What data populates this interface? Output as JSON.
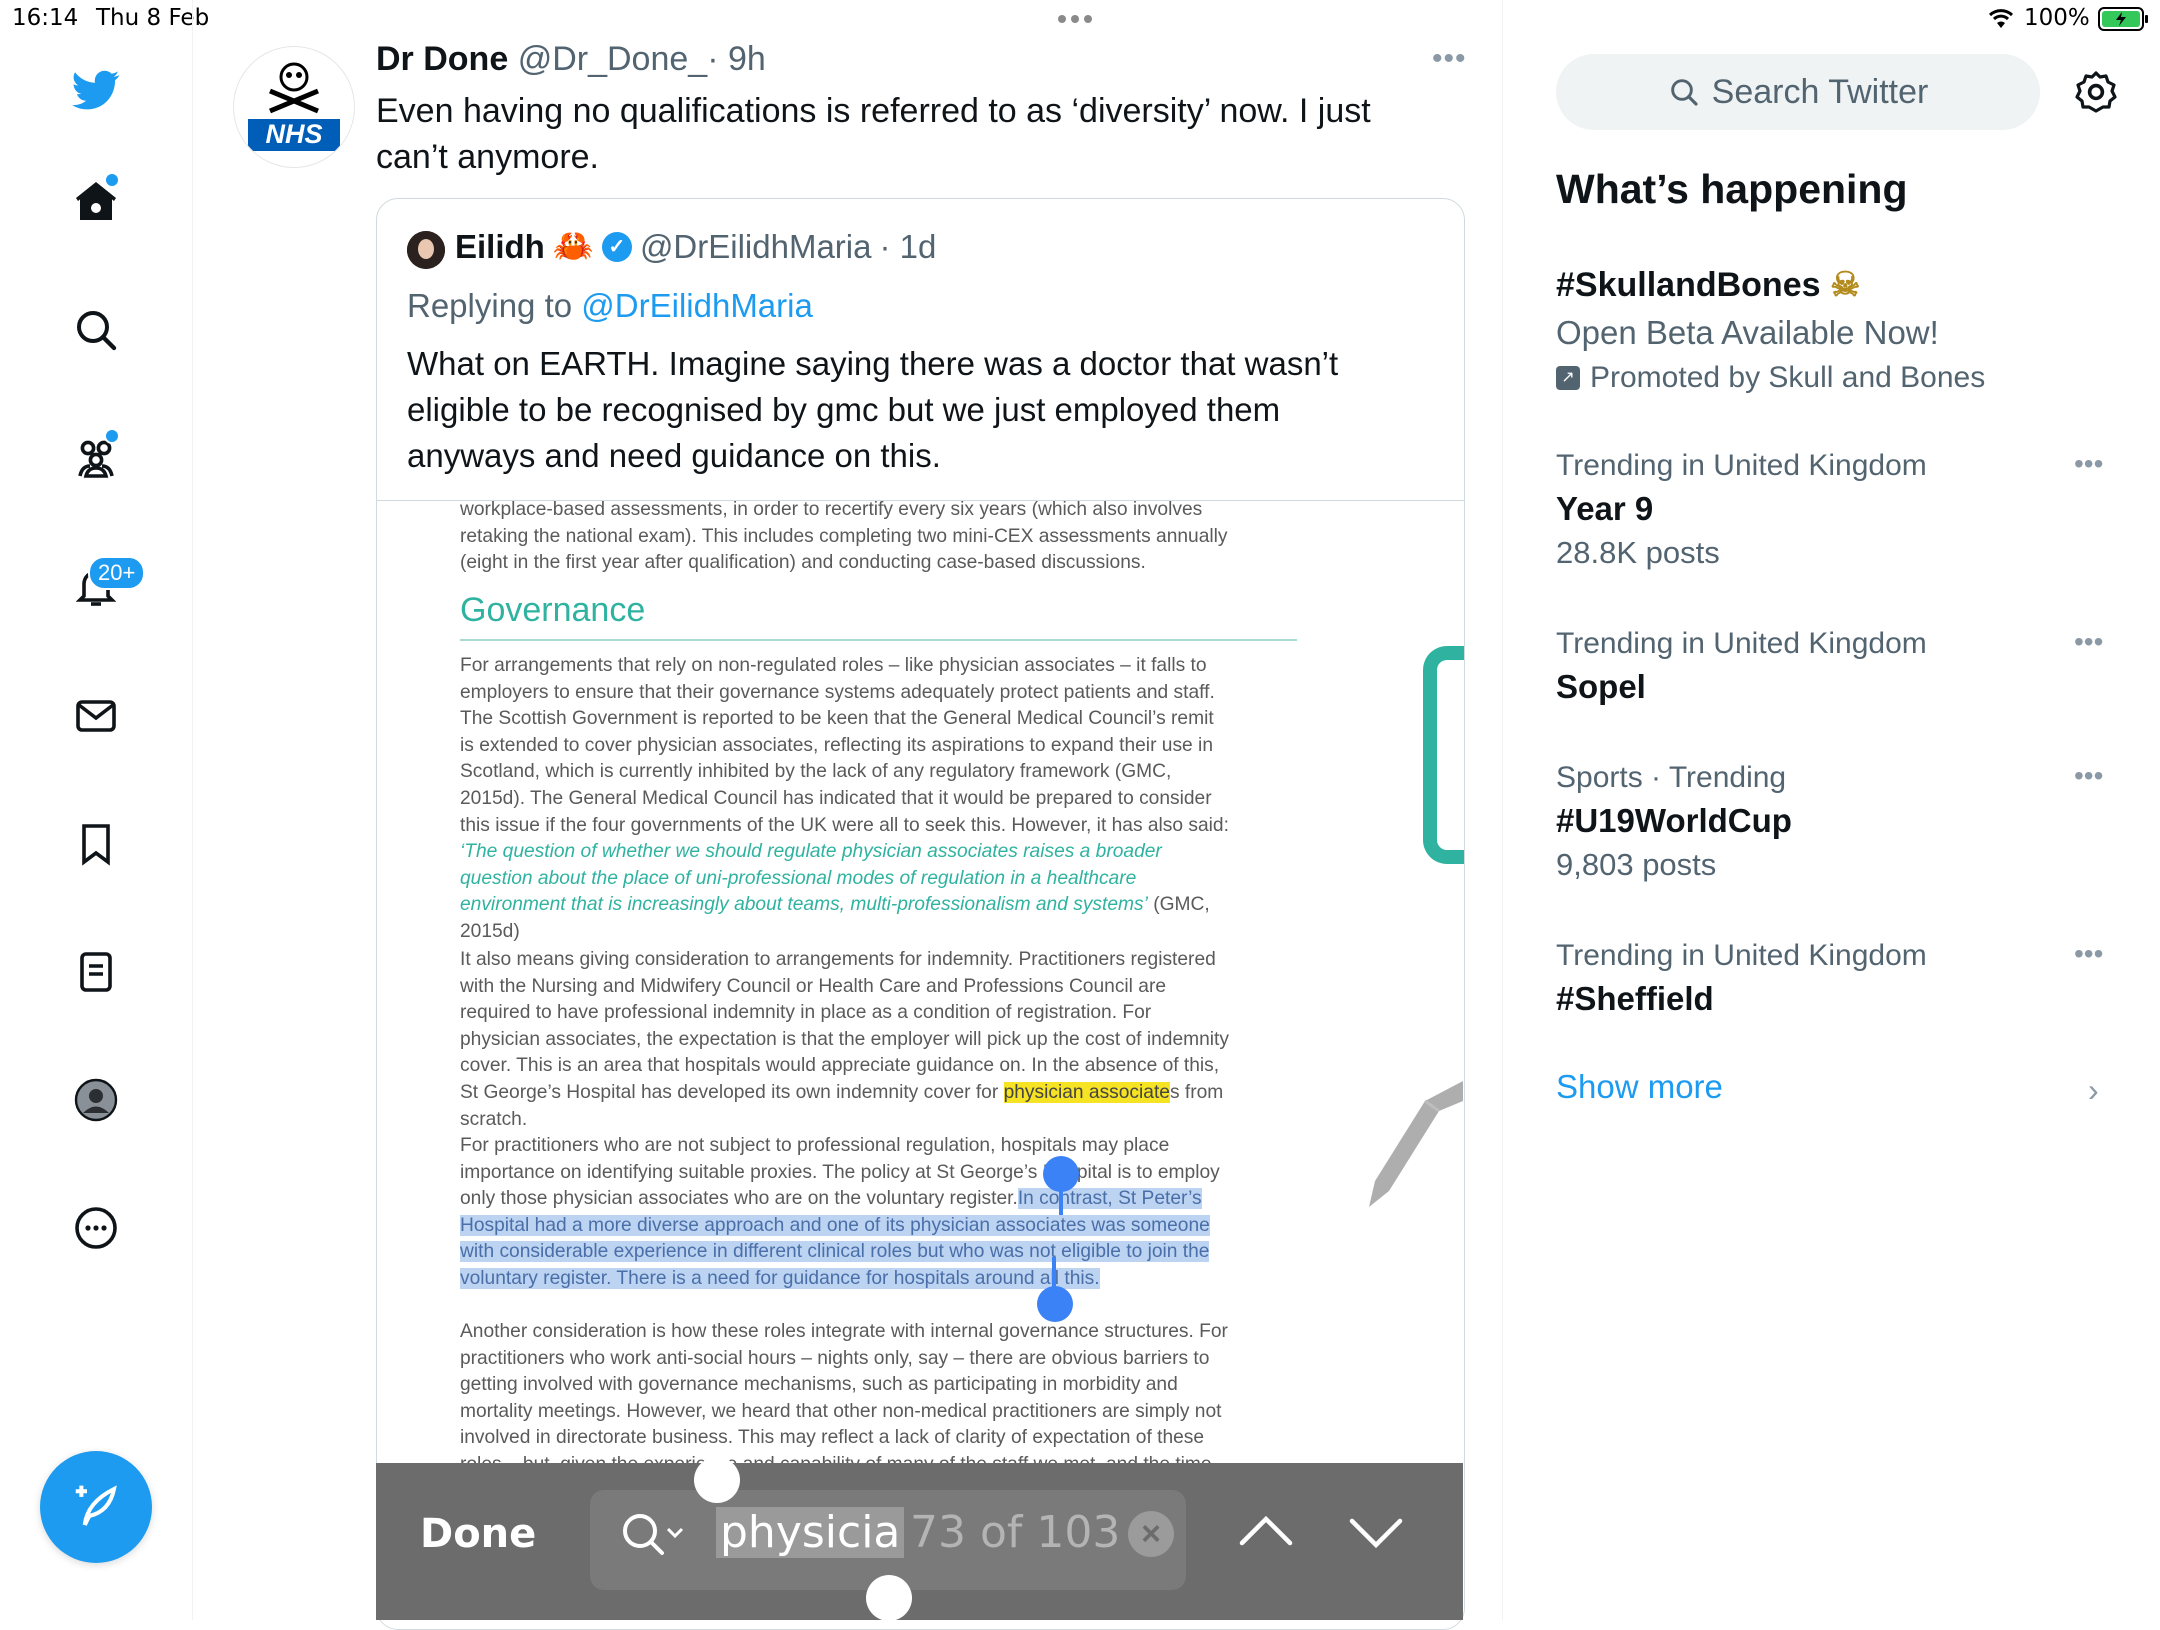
{
  "status": {
    "time": "16:14",
    "date": "Thu 8 Feb",
    "battery": "100%"
  },
  "nav": {
    "notifications_badge": "20+"
  },
  "tweet": {
    "name": "Dr Done",
    "handle": "@Dr_Done_",
    "time": "· 9h",
    "text": "Even having no qualifications is referred to as ‘diversity’ now. I just can’t anymore.",
    "avatar_label": "NHS"
  },
  "quote": {
    "name": "Eilidh",
    "emoji": "🦀",
    "handle": "@DrEilidhMaria",
    "time": "· 1d",
    "replying_prefix": "Replying to",
    "replying_handle": "@DrEilidhMaria",
    "text": "What on EARTH. Imagine saying there was a doctor that wasn’t eligible to be recognised by gmc but we just employed them anyways and need guidance on this."
  },
  "doc": {
    "top_lines": "workplace-based assessments, in order to recertify every six years (which also involves retaking the national exam). This includes completing two mini-CEX assessments annually (eight in the first year after qualification) and conducting case-based discussions.",
    "heading": "Governance",
    "p1_a": "For arrangements that rely on non-regulated roles – like physician associates – it falls to employers to ensure that their governance systems adequately protect patients and staff. The Scottish Government is reported to be keen that the General Medical Council’s remit is extended to cover physician associates, reflecting its aspirations to expand their use in Scotland, which is currently inhibited by the lack of any regulatory framework (GMC, 2015d). The General Medical Council has indicated that it would be prepared to consider this issue if the four governments of the UK were all to seek this. However, it has also said: ",
    "p1_quote": "‘The question of whether we should regulate physician associates raises a broader question about the place of uni-professional modes of regulation in a healthcare environment that is increasingly about teams, multi-professionalism and systems’",
    "p1_b": " (GMC, 2015d)",
    "p2_a": "It also means giving consideration to arrangements for indemnity. Practitioners registered with the Nursing and Midwifery Council or Health Care and Professions Council are required to have professional indemnity in place as a condition of registration. For physician associates, the expectation is that the employer will pick up the cost of indemnity cover. This is an area that hospitals would appreciate guidance on. In the absence of this, St George’s Hospital has developed its own indemnity cover for ",
    "p2_hl": "physician associate",
    "p2_b": "s from scratch.",
    "p3_a": "For practitioners who are not subject to professional regulation, hospitals may place importance on identifying suitable proxies. The policy at St George’s Hospital is to employ only those physician associates who are on the voluntary register.",
    "p3_sel": "In contrast, St Peter’s Hospital had a more diverse approach and one of its physician associates was someone with considerable experience in different clinical roles but who was not eligible to join the voluntary register. There is a need for guidance for hospitals around all this.",
    "p4": "Another consideration is how these roles integrate with internal governance structures. For practitioners who work anti-social hours – nights only, say – there are obvious barriers to getting involved with governance mechanisms, such as participating in morbidity and mortality meetings. However, we heard that other non-medical practitioners are simply not involved in directorate business. This may reflect a lack of clarity of expectation of these roles – but, given the experience and capability of many of the staff we met, and the time they spend on patient"
  },
  "find_bar": {
    "done": "Done",
    "query": "physicia",
    "count": "73 of 103"
  },
  "right": {
    "search_placeholder": "Search Twitter",
    "heading": "What’s happening",
    "promo": {
      "title": "#SkullandBones",
      "subtitle": "Open Beta Available Now!",
      "promoted": "Promoted by Skull and Bones"
    },
    "trends": [
      {
        "meta": "Trending in United Kingdom",
        "title": "Year 9",
        "posts": "28.8K posts"
      },
      {
        "meta": "Trending in United Kingdom",
        "title": "Sopel",
        "posts": ""
      },
      {
        "meta": "Sports · Trending",
        "title": "#U19WorldCup",
        "posts": "9,803 posts"
      },
      {
        "meta": "Trending in United Kingdom",
        "title": "#Sheffield",
        "posts": ""
      }
    ],
    "show_more": "Show more"
  },
  "colors": {
    "accent": "#1d9bf0",
    "teal": "#2fb3a0",
    "highlight": "#f5e324",
    "selection": "#bcd3f2"
  }
}
